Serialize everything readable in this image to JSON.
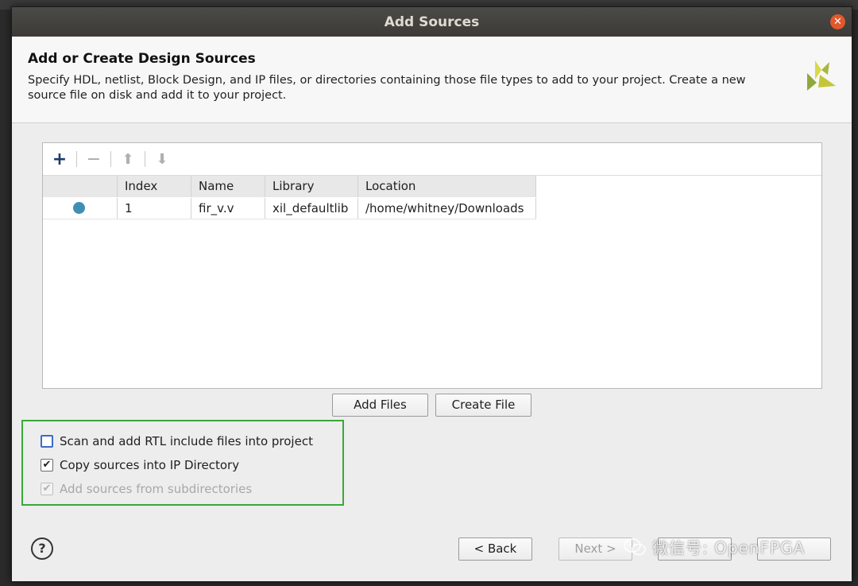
{
  "window": {
    "title": "Add Sources",
    "close_icon": "close-icon"
  },
  "header": {
    "title": "Add or Create Design Sources",
    "description": "Specify HDL, netlist, Block Design, and IP files, or directories containing those file types to add to your project. Create a new source file on disk and add it to your project."
  },
  "toolbar": {
    "icons": [
      "add-icon",
      "remove-icon",
      "move-up-icon",
      "move-down-icon"
    ]
  },
  "table": {
    "columns": [
      "",
      "Index",
      "Name",
      "Library",
      "Location"
    ],
    "rows": [
      {
        "status": "blue-dot",
        "index": "1",
        "name": "fir_v.v",
        "library": "xil_defaultlib",
        "location": "/home/whitney/Downloads"
      }
    ]
  },
  "buttons": {
    "add_files": "Add Files",
    "create_file": "Create File",
    "back": "< Back",
    "next": "Next >"
  },
  "options": [
    {
      "label": "Scan and add RTL include files into project",
      "checked": false,
      "enabled": true
    },
    {
      "label": "Copy sources into IP Directory",
      "checked": true,
      "enabled": true
    },
    {
      "label": "Add sources from subdirectories",
      "checked": true,
      "enabled": false
    }
  ],
  "help_label": "?",
  "watermark": "微信号: OpenFPGA",
  "colors": {
    "accent_highlight": "#3aa83a",
    "status_dot": "#3f8fb4",
    "titlebar": "#3c3b37",
    "close": "#e3582b"
  }
}
